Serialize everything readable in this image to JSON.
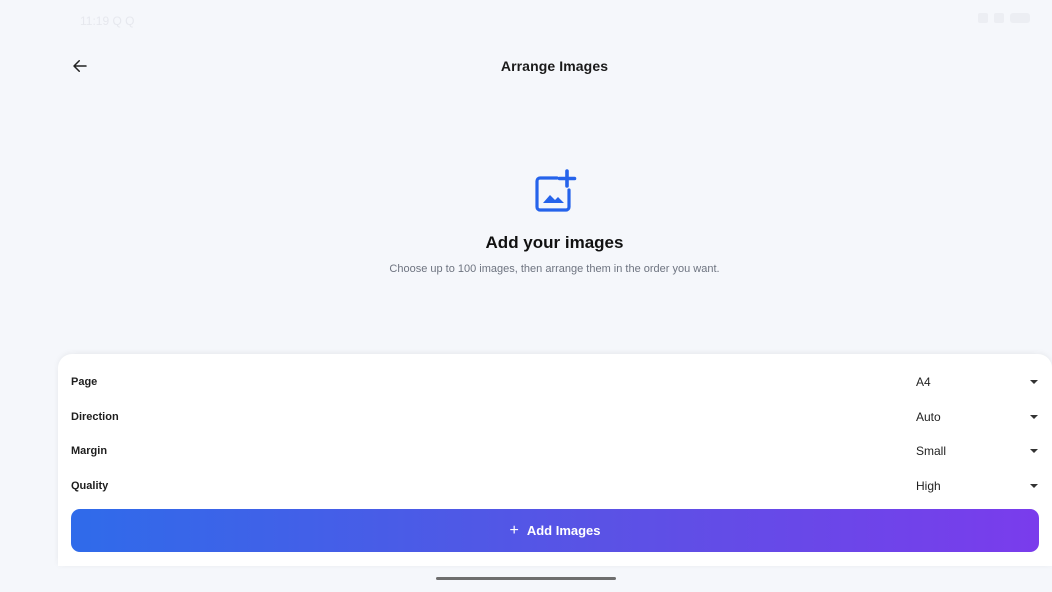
{
  "status_bar": {
    "time": "11:19 Q Q"
  },
  "header": {
    "title": "Arrange Images"
  },
  "empty_state": {
    "title": "Add your images",
    "subtitle": "Choose up to 100 images, then arrange them in the order you want."
  },
  "settings": [
    {
      "label": "Page",
      "value": "A4"
    },
    {
      "label": "Direction",
      "value": "Auto"
    },
    {
      "label": "Margin",
      "value": "Small"
    },
    {
      "label": "Quality",
      "value": "High"
    }
  ],
  "actions": {
    "add_images_label": "Add Images",
    "add_images_icon": "plus-icon"
  },
  "colors": {
    "accent": "#2563eb",
    "gradient_start": "#2f6bea",
    "gradient_end": "#7a3cec",
    "background": "#f5f7fb"
  }
}
